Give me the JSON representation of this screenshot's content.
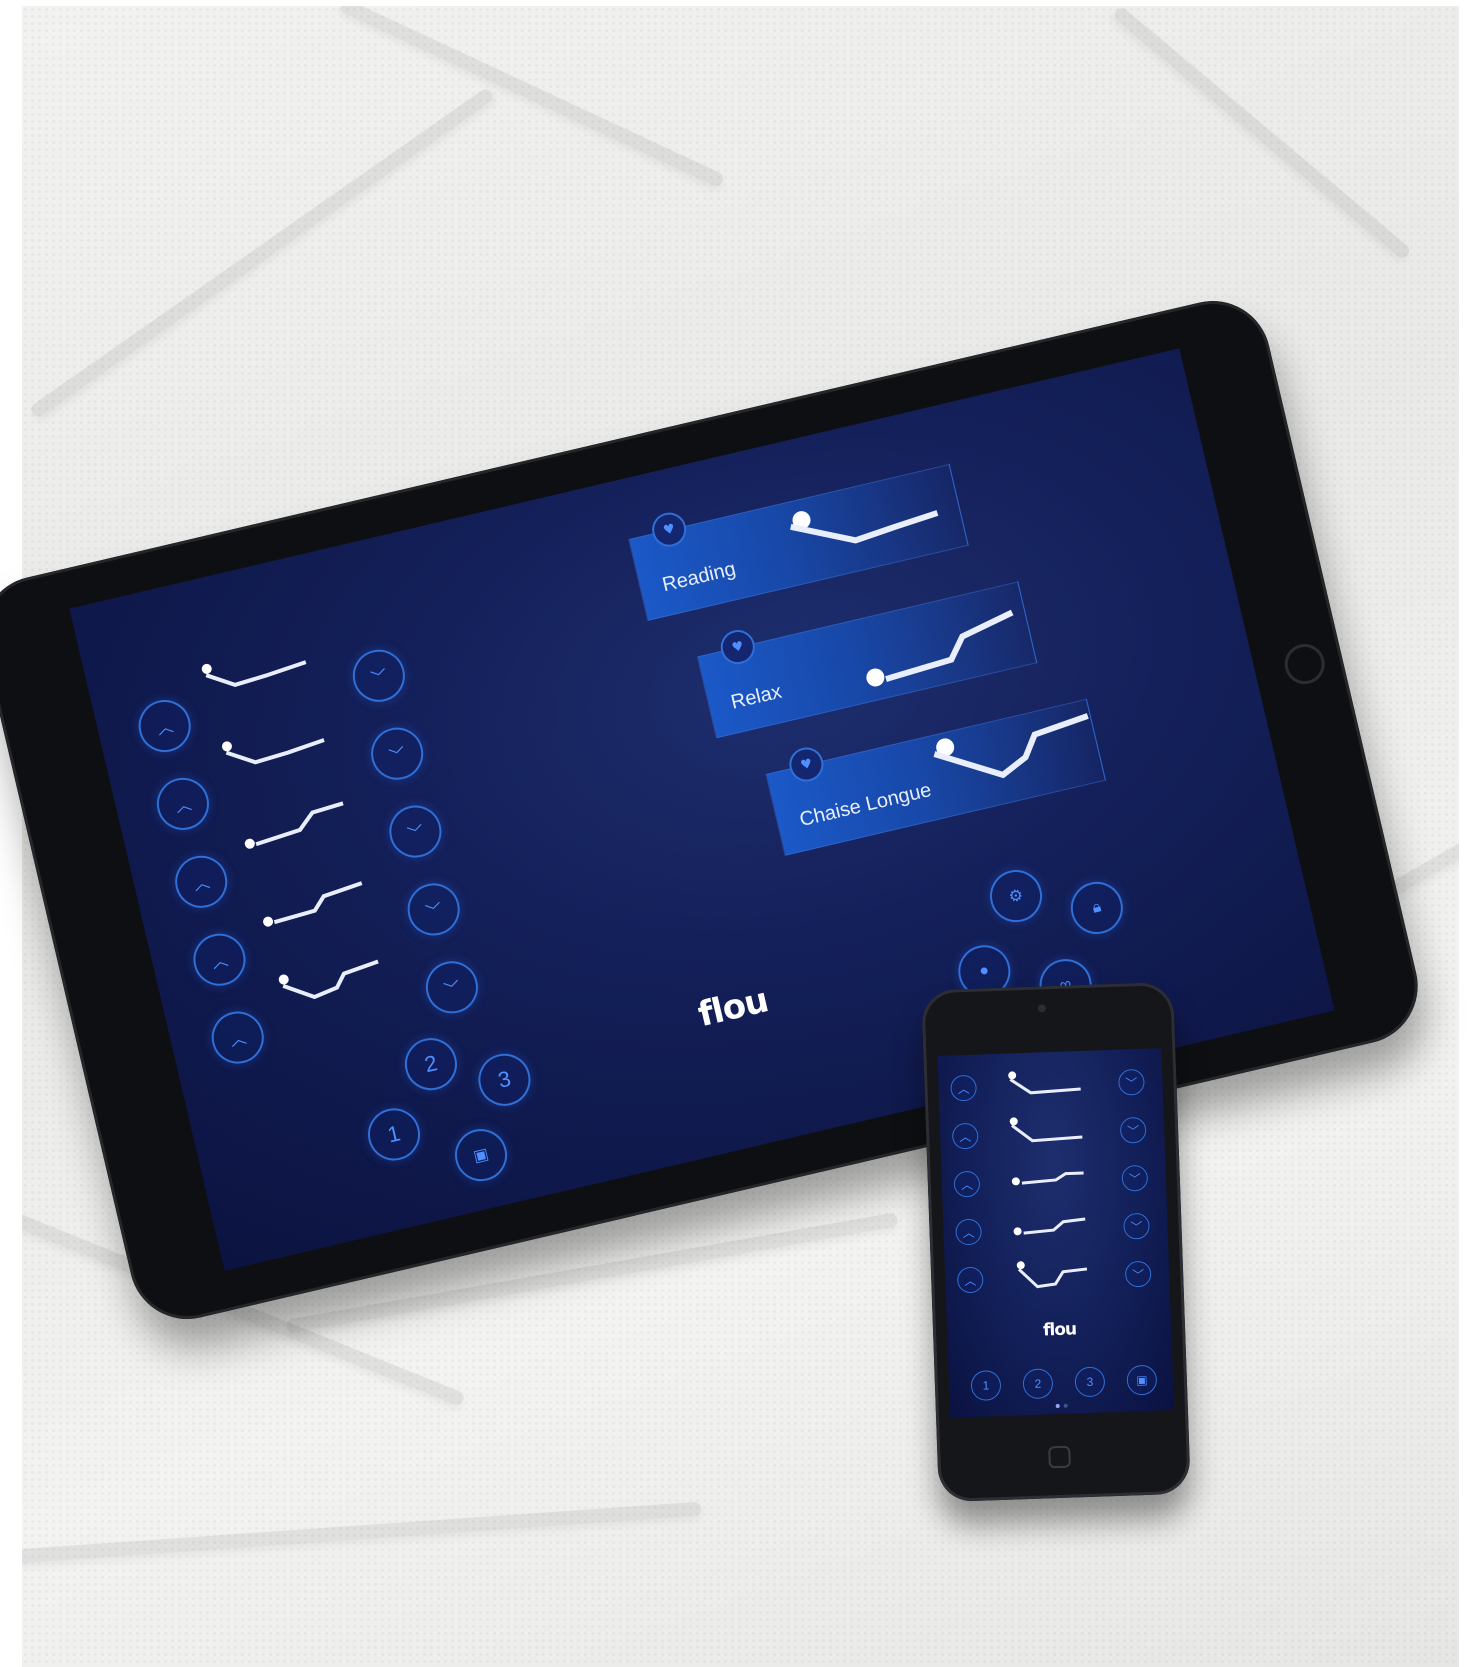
{
  "tablet": {
    "presets": [
      {
        "label": "Reading"
      },
      {
        "label": "Relax"
      },
      {
        "label": "Chaise Longue"
      }
    ],
    "memory_buttons": [
      "1",
      "2",
      "3"
    ],
    "logo": "flou",
    "icons": {
      "up": "chevron-up-icon",
      "down": "chevron-down-icon",
      "settings": "gear-icon",
      "lock": "lock-icon",
      "light": "light-bulb-icon",
      "link": "link-icon",
      "save": "save-icon",
      "favorite": "heart-icon"
    }
  },
  "phone": {
    "memory_buttons": [
      "1",
      "2",
      "3"
    ],
    "logo": "flou"
  },
  "colors": {
    "screen_bg": "#14205a",
    "accent": "#2f6fd6",
    "preset_fill": "#1b59c8"
  }
}
